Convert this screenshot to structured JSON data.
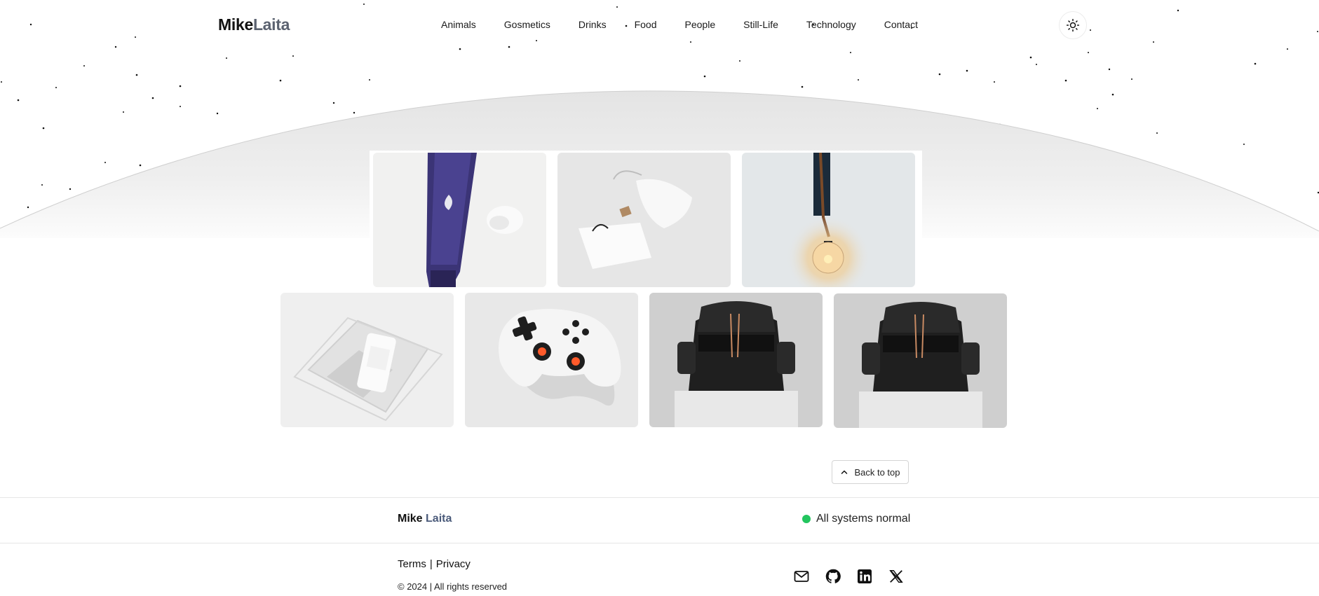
{
  "header": {
    "logo_first": "Mike",
    "logo_second": "Laita",
    "nav": [
      "Animals",
      "Gosmetics",
      "Drinks",
      "Food",
      "People",
      "Still-Life",
      "Technology",
      "Contact"
    ],
    "theme_icon": "sun-icon"
  },
  "gallery": {
    "row1": [
      {
        "subject": "purple cream tube",
        "icon": "image"
      },
      {
        "subject": "white pouch and tag",
        "icon": "image"
      },
      {
        "subject": "hanging bulb lamp",
        "icon": "image"
      }
    ],
    "row2": [
      {
        "subject": "white bottle in clear box",
        "icon": "image"
      },
      {
        "subject": "white game controller",
        "icon": "image"
      },
      {
        "subject": "black leather backpack",
        "icon": "image"
      },
      {
        "subject": "black leather backpack",
        "icon": "image"
      }
    ]
  },
  "back_to_top": {
    "label": "Back to top",
    "icon": "chevron-up-icon"
  },
  "footer": {
    "logo_first": "Mike",
    "logo_second": "Laita",
    "status_text": "All systems normal",
    "status_color": "#22c55e",
    "terms": "Terms",
    "separator": "|",
    "privacy": "Privacy",
    "copyright": "© 2024 | All rights reserved",
    "socials": [
      "mail-icon",
      "github-icon",
      "linkedin-icon",
      "x-icon"
    ]
  }
}
